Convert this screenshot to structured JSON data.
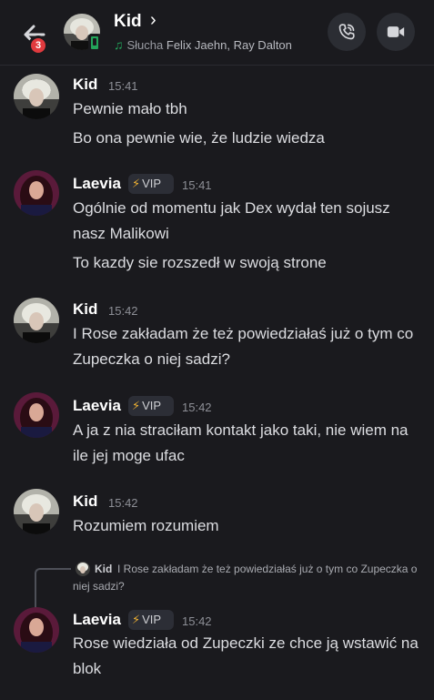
{
  "header": {
    "name": "Kid",
    "chevron": "›",
    "badge_count": "3",
    "activity_prefix": "Słucha",
    "activity_artists": "Felix Jaehn,  Ray Dalton",
    "icons": [
      "back-arrow-icon",
      "music-note-icon",
      "phone-icon",
      "video-camera-icon"
    ]
  },
  "vip_label": "VIP",
  "messages": [
    {
      "author": "Kid",
      "time": "15:41",
      "lines": [
        "Pewnie mało tbh",
        "Bo ona pewnie wie, że ludzie wiedza"
      ]
    },
    {
      "author": "Laevia",
      "time": "15:41",
      "lines": [
        "Ogólnie od momentu jak Dex wydał ten sojusz nasz Malikowi",
        "To kazdy sie rozszedł w swoją strone"
      ]
    },
    {
      "author": "Kid",
      "time": "15:42",
      "lines": [
        "I Rose zakładam że też powiedziałaś już o tym co Zupeczka o niej sadzi?"
      ]
    },
    {
      "author": "Laevia",
      "time": "15:42",
      "lines": [
        "A ja z nia straciłam kontakt jako taki, nie wiem na ile jej moge ufac"
      ]
    },
    {
      "author": "Kid",
      "time": "15:42",
      "lines": [
        "Rozumiem rozumiem"
      ]
    },
    {
      "author": "Laevia",
      "time": "15:42",
      "lines": [
        "Rose wiedziała od Zupeczki ze chce ją wstawić na blok"
      ]
    }
  ],
  "reply": {
    "author": "Kid",
    "text": "I Rose zakładam że też powiedziałaś już o tym co Zupeczka o niej sadzi?"
  },
  "colors": {
    "background": "#1a1a1e",
    "online_green": "#23a55a",
    "badge_red": "#e03a3e",
    "vip_bolt": "#f0b232"
  }
}
